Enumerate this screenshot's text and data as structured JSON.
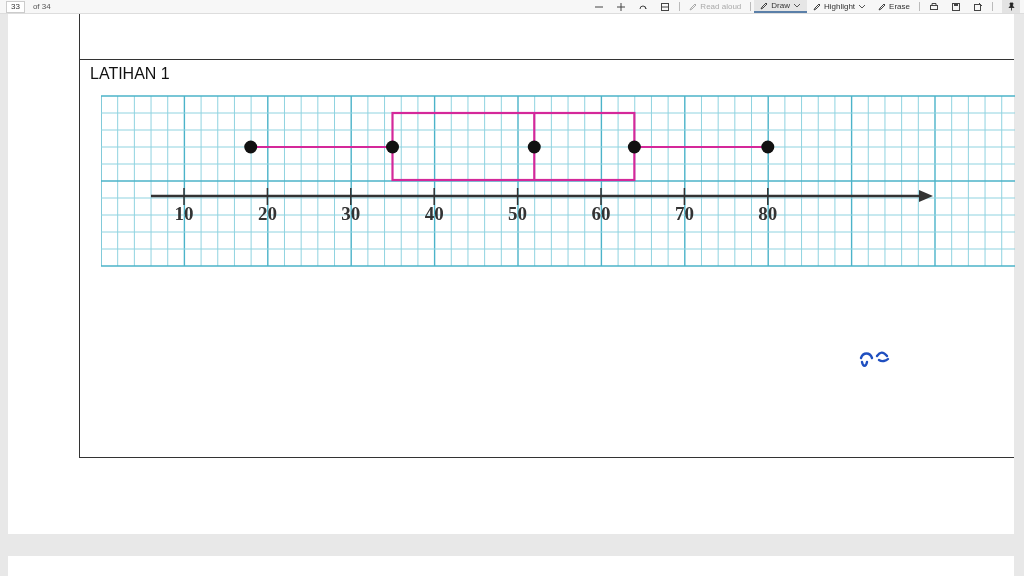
{
  "toolbar": {
    "page_number": "33",
    "page_count": "of 34",
    "tools": [
      {
        "label": "Read aloud",
        "disabled": true,
        "selected": false,
        "menu": false
      },
      {
        "label": "Draw",
        "disabled": false,
        "selected": true,
        "menu": true
      },
      {
        "label": "Highlight",
        "disabled": false,
        "selected": false,
        "menu": true
      },
      {
        "label": "Erase",
        "disabled": false,
        "selected": false,
        "menu": false
      }
    ]
  },
  "document": {
    "heading": "LATIHAN 1",
    "figure": {
      "tick_labels": [
        "10",
        "20",
        "30",
        "40",
        "50",
        "60",
        "70",
        "80"
      ]
    }
  }
}
